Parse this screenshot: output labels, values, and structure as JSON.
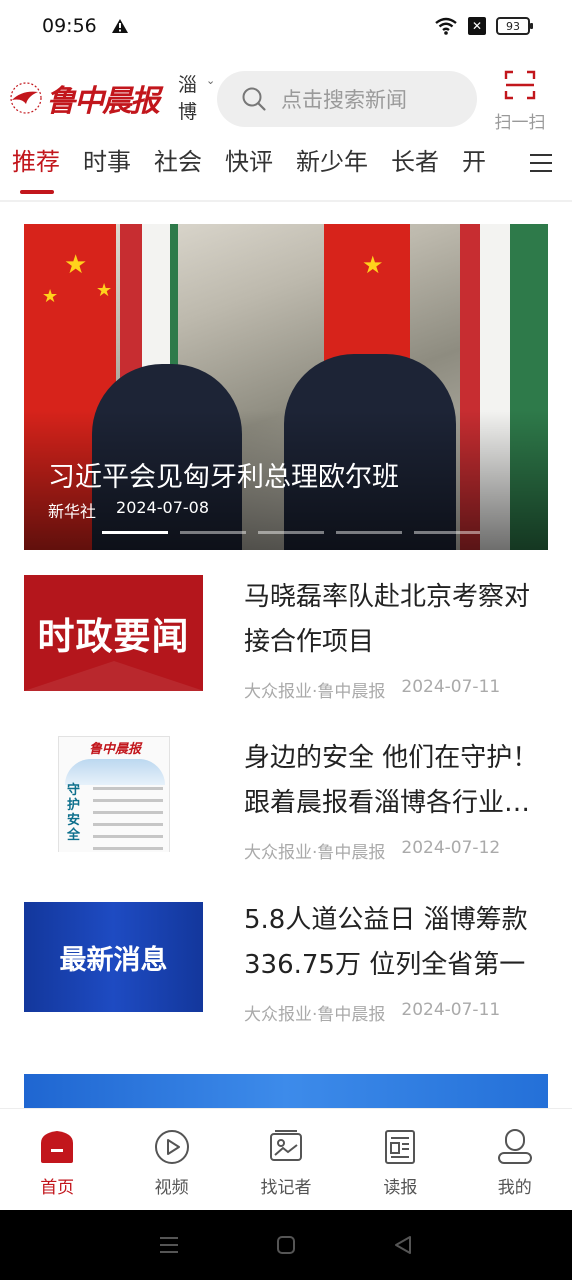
{
  "status_bar": {
    "time": "09:56",
    "battery": "93"
  },
  "header": {
    "logo_text": "鲁中晨报",
    "city": "淄博",
    "search_placeholder": "点击搜索新闻",
    "scan_label": "扫一扫"
  },
  "tabs": [
    "推荐",
    "时事",
    "社会",
    "快评",
    "新少年",
    "长者",
    "开"
  ],
  "active_tab": "推荐",
  "banner": {
    "title": "习近平会见匈牙利总理欧尔班",
    "source": "新华社",
    "date": "2024-07-08",
    "slide_count": 5,
    "current_slide": 1
  },
  "articles": [
    {
      "title": "马晓磊率队赴北京考察对接合作项目",
      "source": "大众报业·鲁中晨报",
      "date": "2024-07-11",
      "thumb_text": "时政要闻"
    },
    {
      "title": "身边的安全 他们在守护！跟着晨报看淄博各行业…",
      "source": "大众报业·鲁中晨报",
      "date": "2024-07-12",
      "thumb_text": "守护安全",
      "thumb_masthead": "鲁中晨报"
    },
    {
      "title": "5.8人道公益日 淄博筹款336.75万 位列全省第一",
      "source": "大众报业·鲁中晨报",
      "date": "2024-07-11",
      "thumb_text": "最新消息"
    }
  ],
  "bottom_nav": [
    {
      "label": "首页",
      "icon": "home-icon",
      "active": true
    },
    {
      "label": "视频",
      "icon": "video-play-icon",
      "active": false
    },
    {
      "label": "找记者",
      "icon": "reporter-icon",
      "active": false
    },
    {
      "label": "读报",
      "icon": "newspaper-icon",
      "active": false
    },
    {
      "label": "我的",
      "icon": "profile-icon",
      "active": false
    }
  ],
  "colors": {
    "brand_red": "#c2161c",
    "muted_gray": "#aaaaaa"
  }
}
